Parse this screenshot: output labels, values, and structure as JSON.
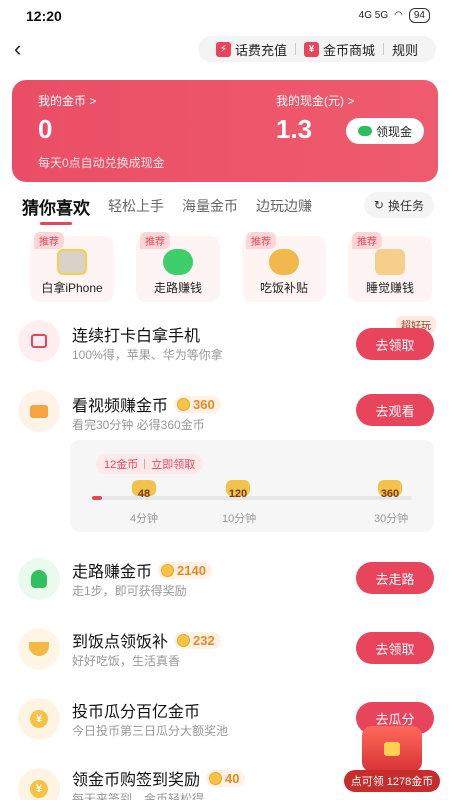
{
  "status_bar": {
    "time": "12:20",
    "network": "4G 5G",
    "battery": "94"
  },
  "nav": {
    "recharge": "话费充值",
    "coin_mall": "金币商城",
    "rules": "规则"
  },
  "hero": {
    "coins_label": "我的金币 >",
    "coins_value": "0",
    "cash_label": "我的现金(元) >",
    "cash_value": "1.3",
    "withdraw_label": "领现金",
    "note": "每天0点自动兑换成现金"
  },
  "tabs": [
    {
      "label": "猜你喜欢"
    },
    {
      "label": "轻松上手"
    },
    {
      "label": "海量金币"
    },
    {
      "label": "边玩边赚"
    }
  ],
  "switch_label": "换任务",
  "quick_items": [
    {
      "badge": "推荐",
      "label": "白拿iPhone"
    },
    {
      "badge": "推荐",
      "label": "走路赚钱"
    },
    {
      "badge": "推荐",
      "label": "吃饭补贴"
    },
    {
      "badge": "推荐",
      "label": "睡觉赚钱"
    }
  ],
  "tasks": [
    {
      "title": "连续打卡白拿手机",
      "coins": "",
      "desc": "100%得，苹果、华为等你拿",
      "action": "去领取",
      "tag": "超好玩",
      "icon": "phone-box-icon"
    },
    {
      "title": "看视频赚金币",
      "coins": "360",
      "desc": "看完30分钟 必得360金币",
      "action": "去观看",
      "tag": "",
      "icon": "video-camera-icon"
    },
    {
      "title": "走路赚金币",
      "coins": "2140",
      "desc": "走1步，即可获得奖励",
      "action": "去走路",
      "tag": "",
      "icon": "walking-person-icon"
    },
    {
      "title": "到饭点领饭补",
      "coins": "232",
      "desc": "好好吃饭，生活真香",
      "action": "去领取",
      "tag": "",
      "icon": "meal-bowl-icon"
    },
    {
      "title": "投币瓜分百亿金币",
      "coins": "",
      "desc": "今日投币第三日瓜分大额奖池",
      "action": "去瓜分",
      "tag": "",
      "icon": "coin-yuan-icon"
    },
    {
      "title": "领金币购签到奖励",
      "coins": "40",
      "desc": "每天来签到，金币轻松得",
      "action": "",
      "tag": "",
      "icon": "coin-yuan-icon"
    }
  ],
  "video_progress": {
    "chip_left": "12金币",
    "chip_right": "立即领取",
    "progress": 0.03,
    "milestones": [
      {
        "coins": "48",
        "time": "4分钟"
      },
      {
        "coins": "120",
        "time": "10分钟"
      },
      {
        "coins": "360",
        "time": "30分钟"
      }
    ]
  },
  "float_reward": {
    "label": "点可领 1278金币"
  },
  "colors": {
    "accent": "#e8455d",
    "coin": "#f6c444"
  }
}
